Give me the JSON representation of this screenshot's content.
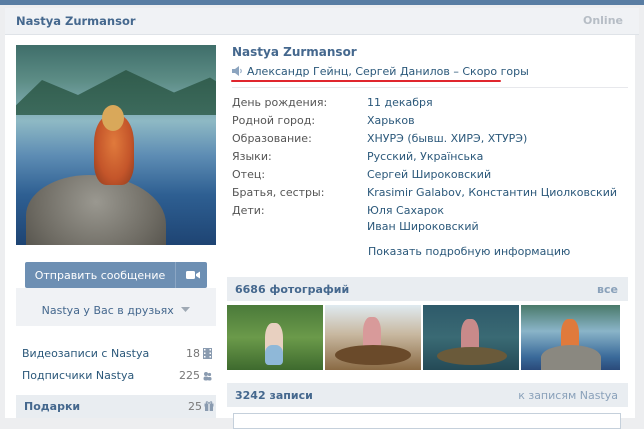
{
  "header": {
    "name": "Nastya Zurmansor",
    "status": "Online"
  },
  "left": {
    "send_message": "Отправить сообщение",
    "in_friends": "Nastya у Вас в друзьях",
    "videos": {
      "label": "Видеозаписи с Nastya",
      "count": "18"
    },
    "subscribers": {
      "label": "Подписчики Nastya",
      "count": "225"
    },
    "gifts": {
      "label": "Подарки",
      "count": "25"
    }
  },
  "profile": {
    "name": "Nastya Zurmansor",
    "now_playing": "Александр Гейнц, Сергей Данилов – Скоро горы",
    "info": [
      {
        "label": "День рождения:",
        "value": "11 декабря"
      },
      {
        "label": "Родной город:",
        "value": "Харьков"
      },
      {
        "label": "Образование:",
        "value": "ХНУРЭ (бывш. ХИРЭ, ХТУРЭ)"
      },
      {
        "label": "Языки:",
        "value": "Русский, Українська"
      },
      {
        "label": "Отец:",
        "value": "Сергей Широковский"
      },
      {
        "label": "Братья, сестры:",
        "value": "Krasimir Galabov, Константин Циолковский"
      },
      {
        "label": "Дети:",
        "value": "Юля Сахарок"
      },
      {
        "label": "",
        "value": "Иван Широковский"
      }
    ],
    "more_info": "Показать подробную информацию"
  },
  "photos": {
    "title": "6686 фотографий",
    "all": "все"
  },
  "posts": {
    "title": "3242 записи",
    "to_posts": "к записям Nastya"
  },
  "colors": {
    "accent": "#45688e",
    "link": "#2b587a",
    "button": "#6d8fb3",
    "underline": "#e0262e"
  }
}
